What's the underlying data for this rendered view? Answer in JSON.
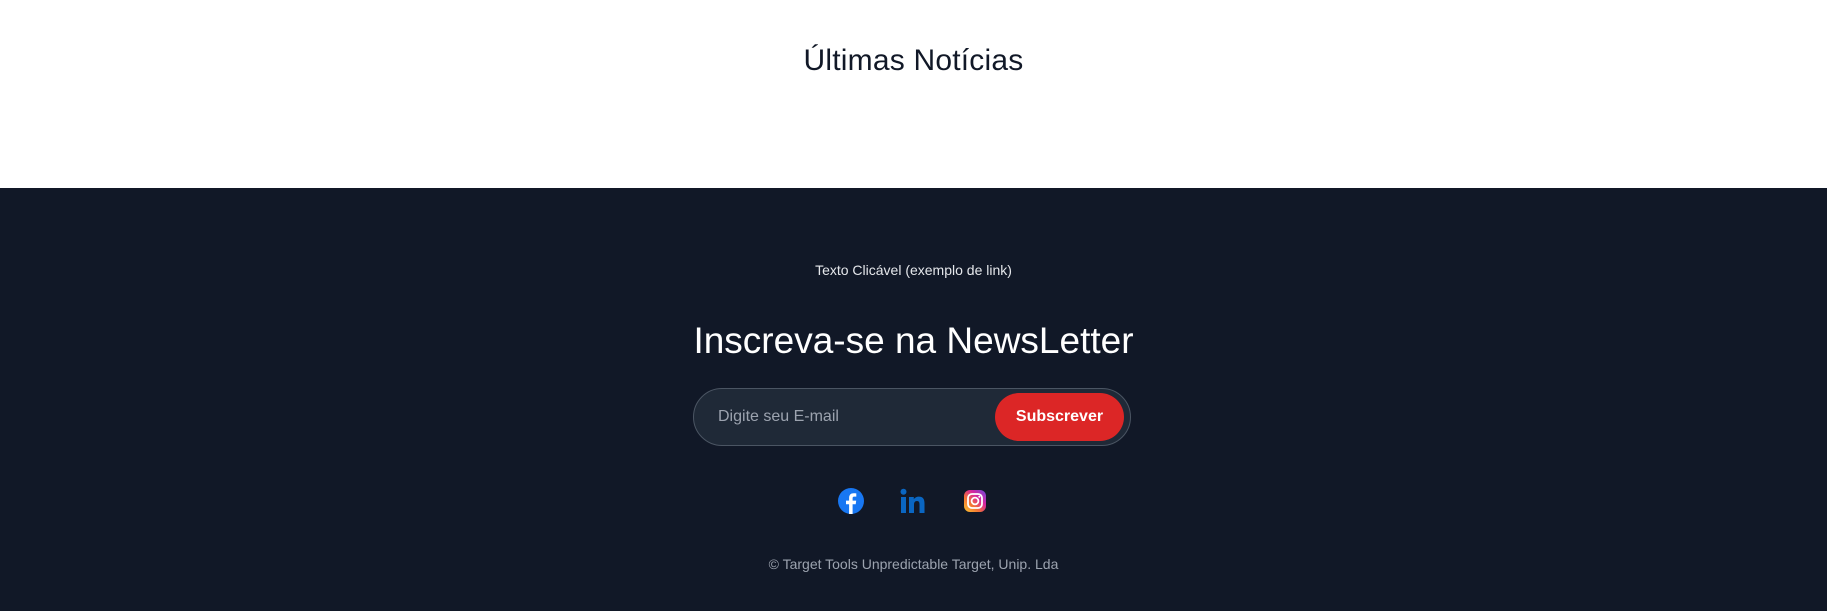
{
  "news": {
    "title": "Últimas Notícias"
  },
  "footer": {
    "link_text": "Texto Clicável (exemplo de link)",
    "newsletter": {
      "title": "Inscreva-se na NewsLetter",
      "email_placeholder": "Digite seu E-mail",
      "email_value": "",
      "subscribe_label": "Subscrever"
    },
    "socials": [
      {
        "name": "Facebook",
        "icon": "facebook-icon"
      },
      {
        "name": "LinkedIn",
        "icon": "linkedin-icon"
      },
      {
        "name": "Instagram",
        "icon": "instagram-icon"
      }
    ],
    "copyright": "© Target Tools Unpredictable Target, Unip. Lda"
  },
  "colors": {
    "footer_background": "#111827",
    "accent": "#dc2626",
    "facebook": "#1877f2",
    "linkedin": "#0a66c2"
  }
}
